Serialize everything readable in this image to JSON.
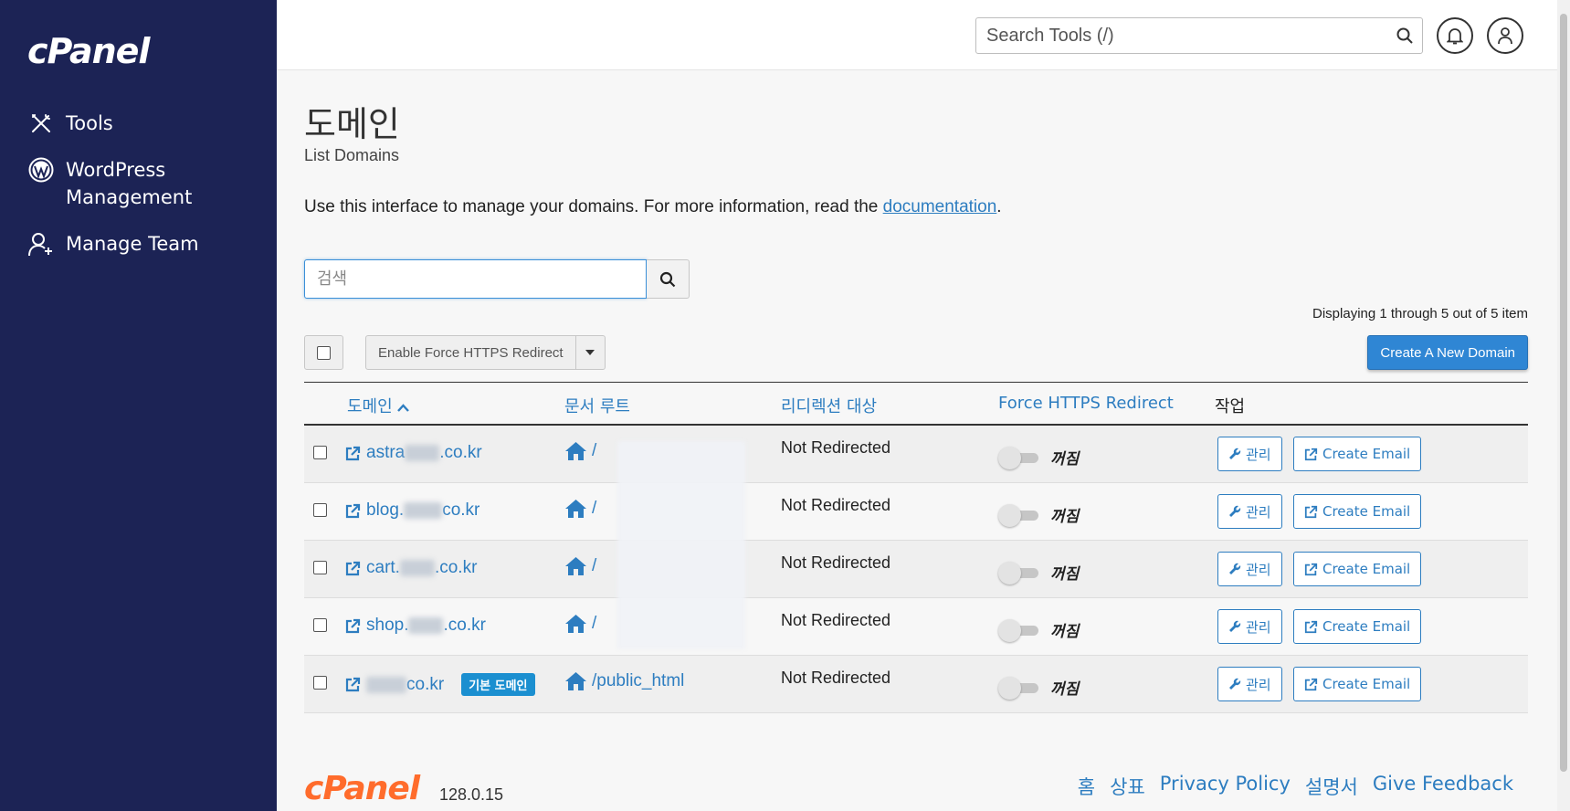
{
  "app": {
    "logo": "cPanel"
  },
  "sidebar": {
    "items": [
      {
        "label": "Tools",
        "icon": "tools-icon"
      },
      {
        "label": "WordPress Management",
        "icon": "wordpress-icon"
      },
      {
        "label": "Manage Team",
        "icon": "manage-team-icon"
      }
    ]
  },
  "header": {
    "search_placeholder": "Search Tools (/)"
  },
  "page": {
    "title": "도메인",
    "subtitle": "List Domains",
    "intro_text": "Use this interface to manage your domains. For more information, read the ",
    "intro_link": "documentation",
    "intro_end": "."
  },
  "toolbar": {
    "search_placeholder": "검색",
    "displaying": "Displaying 1 through 5 out of 5 item",
    "bulk_action": "Enable Force HTTPS Redirect",
    "create_button": "Create A New Domain"
  },
  "table": {
    "columns": [
      "도메인",
      "문서 루트",
      "리디렉션 대상",
      "Force HTTPS Redirect",
      "작업"
    ],
    "rows": [
      {
        "domain_prefix": "astra",
        "domain_suffix": ".co.kr",
        "root": "/",
        "redirect": "Not Redirected",
        "https": "꺼짐",
        "manage": "관리",
        "email": "Create Email",
        "badge": ""
      },
      {
        "domain_prefix": "blog.",
        "domain_suffix": "co.kr",
        "root": "/",
        "redirect": "Not Redirected",
        "https": "꺼짐",
        "manage": "관리",
        "email": "Create Email",
        "badge": ""
      },
      {
        "domain_prefix": "cart.",
        "domain_suffix": ".co.kr",
        "root": "/",
        "redirect": "Not Redirected",
        "https": "꺼짐",
        "manage": "관리",
        "email": "Create Email",
        "badge": ""
      },
      {
        "domain_prefix": "shop.",
        "domain_suffix": ".co.kr",
        "root": "/",
        "redirect": "Not Redirected",
        "https": "꺼짐",
        "manage": "관리",
        "email": "Create Email",
        "badge": ""
      },
      {
        "domain_prefix": "",
        "domain_suffix": "co.kr",
        "root": "/public_html",
        "redirect": "Not Redirected",
        "https": "꺼짐",
        "manage": "관리",
        "email": "Create Email",
        "badge": "기본 도메인"
      }
    ]
  },
  "footer": {
    "logo": "cPanel",
    "version": "128.0.15",
    "links": [
      "홈",
      "상표",
      "Privacy Policy",
      "설명서",
      "Give Feedback"
    ]
  },
  "colors": {
    "sidebar_bg": "#1c2355",
    "link": "#2d7dc0",
    "primary_button": "#2f86d4",
    "badge": "#1b8fd0",
    "footer_logo": "#ff6c2c"
  }
}
